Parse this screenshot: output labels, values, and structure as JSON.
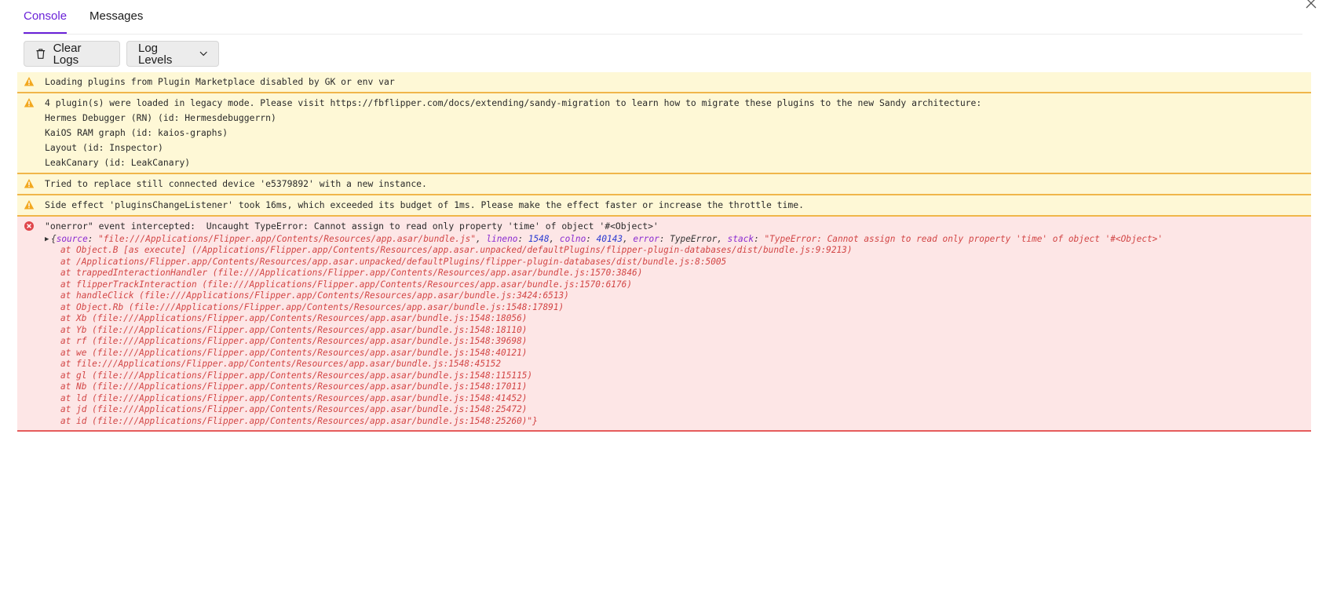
{
  "tabs": [
    {
      "label": "Console",
      "active": true
    },
    {
      "label": "Messages",
      "active": false
    }
  ],
  "toolbar": {
    "clear_label": "Clear Logs",
    "levels_label": "Log Levels"
  },
  "colors": {
    "accent": "#6a22d8",
    "warn_bg": "#fef8d6",
    "warn_border": "#f0b64a",
    "error_bg": "#fde6e6",
    "error_border": "#e65c5c"
  },
  "logs": [
    {
      "level": "warning",
      "icon": "warning-icon",
      "lines": [
        "Loading plugins from Plugin Marketplace disabled by GK or env var"
      ]
    },
    {
      "level": "warning",
      "icon": "warning-icon",
      "lines": [
        "4 plugin(s) were loaded in legacy mode. Please visit https://fbflipper.com/docs/extending/sandy-migration to learn how to migrate these plugins to the new Sandy architecture:",
        "Hermes Debugger (RN) (id: Hermesdebuggerrn)",
        "KaiOS RAM graph (id: kaios-graphs)",
        "Layout (id: Inspector)",
        "LeakCanary (id: LeakCanary)"
      ]
    },
    {
      "level": "warning",
      "icon": "warning-icon",
      "lines": [
        "Tried to replace still connected device 'e5379892' with a new instance."
      ]
    },
    {
      "level": "warning",
      "icon": "warning-icon",
      "lines": [
        "Side effect 'pluginsChangeListener' took 16ms, which exceeded its budget of 1ms. Please make the effect faster or increase the throttle time."
      ]
    }
  ],
  "error": {
    "icon": "error-icon",
    "message": "\"onerror\" event intercepted:  Uncaught TypeError: Cannot assign to read only property 'time' of object '#<Object>'",
    "object": {
      "open": "{",
      "source_key": "source",
      "source_val": "\"file:///Applications/Flipper.app/Contents/Resources/app.asar/bundle.js\"",
      "lineno_key": "lineno",
      "lineno_val": "1548",
      "colno_key": "colno",
      "colno_val": "40143",
      "error_key": "error",
      "error_val": "TypeError",
      "stack_key": "stack",
      "stack_val": "\"TypeError: Cannot assign to read only property 'time' of object '#<Object>'"
    },
    "frames": [
      "at Object.B [as execute] (/Applications/Flipper.app/Contents/Resources/app.asar.unpacked/defaultPlugins/flipper-plugin-databases/dist/bundle.js:9:9213)",
      "at /Applications/Flipper.app/Contents/Resources/app.asar.unpacked/defaultPlugins/flipper-plugin-databases/dist/bundle.js:8:5005",
      "at trappedInteractionHandler (file:///Applications/Flipper.app/Contents/Resources/app.asar/bundle.js:1570:3846)",
      "at flipperTrackInteraction (file:///Applications/Flipper.app/Contents/Resources/app.asar/bundle.js:1570:6176)",
      "at handleClick (file:///Applications/Flipper.app/Contents/Resources/app.asar/bundle.js:3424:6513)",
      "at Object.Rb (file:///Applications/Flipper.app/Contents/Resources/app.asar/bundle.js:1548:17891)",
      "at Xb (file:///Applications/Flipper.app/Contents/Resources/app.asar/bundle.js:1548:18056)",
      "at Yb (file:///Applications/Flipper.app/Contents/Resources/app.asar/bundle.js:1548:18110)",
      "at rf (file:///Applications/Flipper.app/Contents/Resources/app.asar/bundle.js:1548:39698)",
      "at we (file:///Applications/Flipper.app/Contents/Resources/app.asar/bundle.js:1548:40121)",
      "at file:///Applications/Flipper.app/Contents/Resources/app.asar/bundle.js:1548:45152",
      "at gl (file:///Applications/Flipper.app/Contents/Resources/app.asar/bundle.js:1548:115115)",
      "at Nb (file:///Applications/Flipper.app/Contents/Resources/app.asar/bundle.js:1548:17011)",
      "at ld (file:///Applications/Flipper.app/Contents/Resources/app.asar/bundle.js:1548:41452)",
      "at jd (file:///Applications/Flipper.app/Contents/Resources/app.asar/bundle.js:1548:25472)",
      "at id (file:///Applications/Flipper.app/Contents/Resources/app.asar/bundle.js:1548:25260)\"}"
    ]
  }
}
